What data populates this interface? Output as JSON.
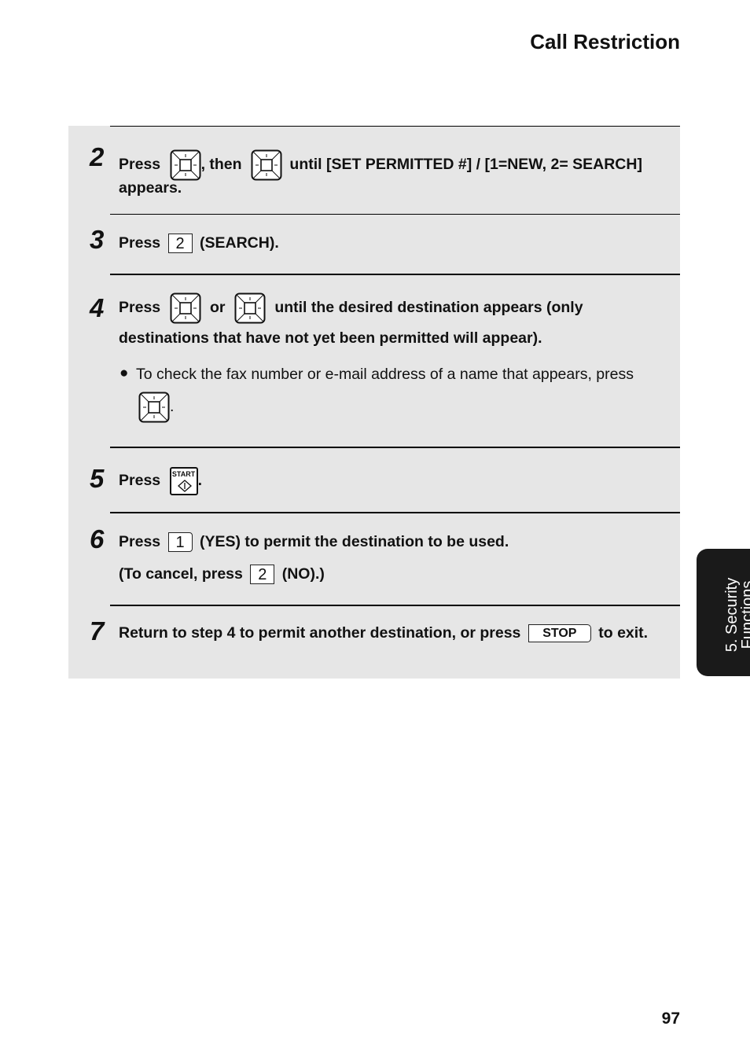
{
  "header": {
    "title": "Call Restriction"
  },
  "steps": {
    "s2": {
      "number": "2",
      "press": "Press",
      "then": ", then",
      "text_a": "until [SET PERMITTED #] / [1=NEW, 2= SEARCH]",
      "text_b": "appears.",
      "icon1": "nav-key-right-icon",
      "icon2": "nav-key-down-icon"
    },
    "s3": {
      "number": "3",
      "press": "Press",
      "key": "2",
      "text": "(SEARCH)."
    },
    "s4": {
      "number": "4",
      "press": "Press",
      "or": "or",
      "text_a": "until the desired destination appears (only",
      "text_b": "destinations that have not yet been permitted will appear).",
      "bullet": "To check the fax number or e-mail address of a name that appears,  press",
      "bullet_end": "."
    },
    "s5": {
      "number": "5",
      "press": "Press",
      "key": "START",
      "end": "."
    },
    "s6": {
      "number": "6",
      "press": "Press",
      "key": "1",
      "text": "(YES) to permit the destination to be used.",
      "cancel_a": "(To cancel, press",
      "cancel_key": "2",
      "cancel_b": "(NO).)"
    },
    "s7": {
      "number": "7",
      "text": "Return to step 4 to permit another destination, or press",
      "key": "STOP",
      "end": "to exit."
    }
  },
  "side_tab": {
    "line1": "5. Security",
    "line2": "Functions"
  },
  "page_number": "97"
}
